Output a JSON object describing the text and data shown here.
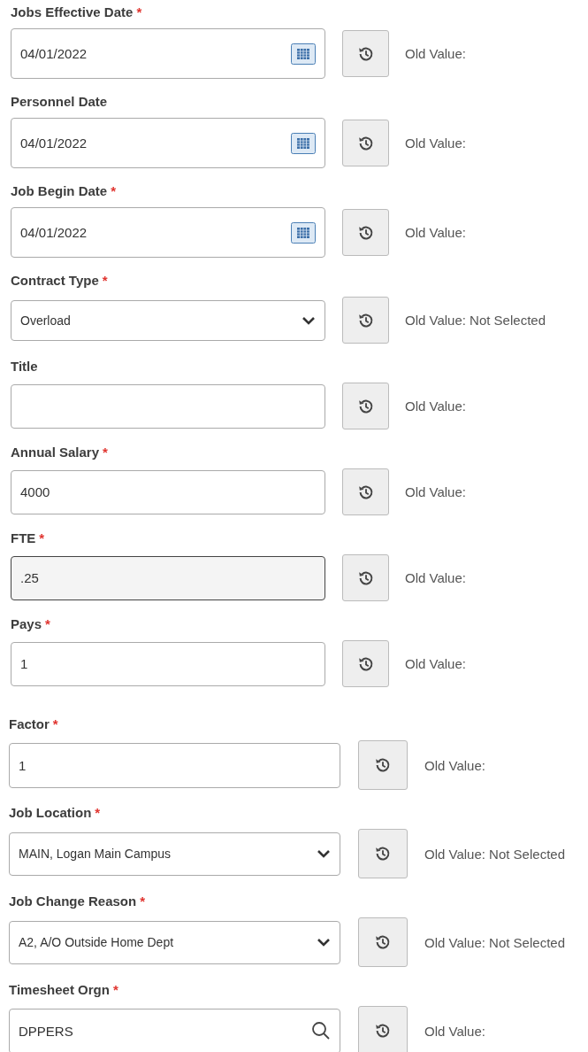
{
  "groups": [
    {
      "fields": [
        {
          "label": "Jobs Effective Date",
          "required_mark": "*",
          "kind": "date",
          "value": "04/01/2022",
          "focused": false,
          "old_value": "Old Value:"
        },
        {
          "label": "Personnel Date",
          "kind": "date",
          "value": "04/01/2022",
          "focused": false,
          "old_value": "Old Value:"
        },
        {
          "label": "Job Begin Date",
          "required_mark": "*",
          "kind": "date",
          "value": "04/01/2022",
          "focused": false,
          "old_value": "Old Value:"
        },
        {
          "label": "Contract Type",
          "required_mark": "*",
          "kind": "select",
          "value": "Overload",
          "focused": false,
          "old_value": "Old Value: Not Selected"
        },
        {
          "label": "Title",
          "kind": "text",
          "focused": false,
          "old_value": "Old Value:"
        },
        {
          "label": "Annual Salary",
          "required_mark": "*",
          "kind": "text",
          "value": "4000",
          "focused": false,
          "old_value": "Old Value:"
        },
        {
          "label": "FTE",
          "required_mark": "*",
          "kind": "text",
          "value": ".25",
          "focused": true,
          "old_value": "Old Value:"
        },
        {
          "label": "Pays",
          "required_mark": "*",
          "kind": "text",
          "value": "1",
          "focused": false,
          "old_value": "Old Value:"
        }
      ]
    },
    {
      "fields": [
        {
          "label": "Factor",
          "required_mark": "*",
          "kind": "text",
          "value": "1",
          "focused": false,
          "old_value": "Old Value:"
        },
        {
          "label": "Job Location",
          "required_mark": "*",
          "kind": "select",
          "value": "MAIN, Logan Main Campus",
          "focused": false,
          "old_value": "Old Value: Not Selected"
        },
        {
          "label": "Job Change Reason",
          "required_mark": "*",
          "kind": "select",
          "value": "A2, A/O Outside Home Dept",
          "focused": false,
          "old_value": "Old Value: Not Selected"
        },
        {
          "label": "Timesheet Orgn",
          "required_mark": "*",
          "kind": "search",
          "value": "DPPERS",
          "focused": false,
          "old_value": "Old Value:"
        }
      ]
    }
  ]
}
